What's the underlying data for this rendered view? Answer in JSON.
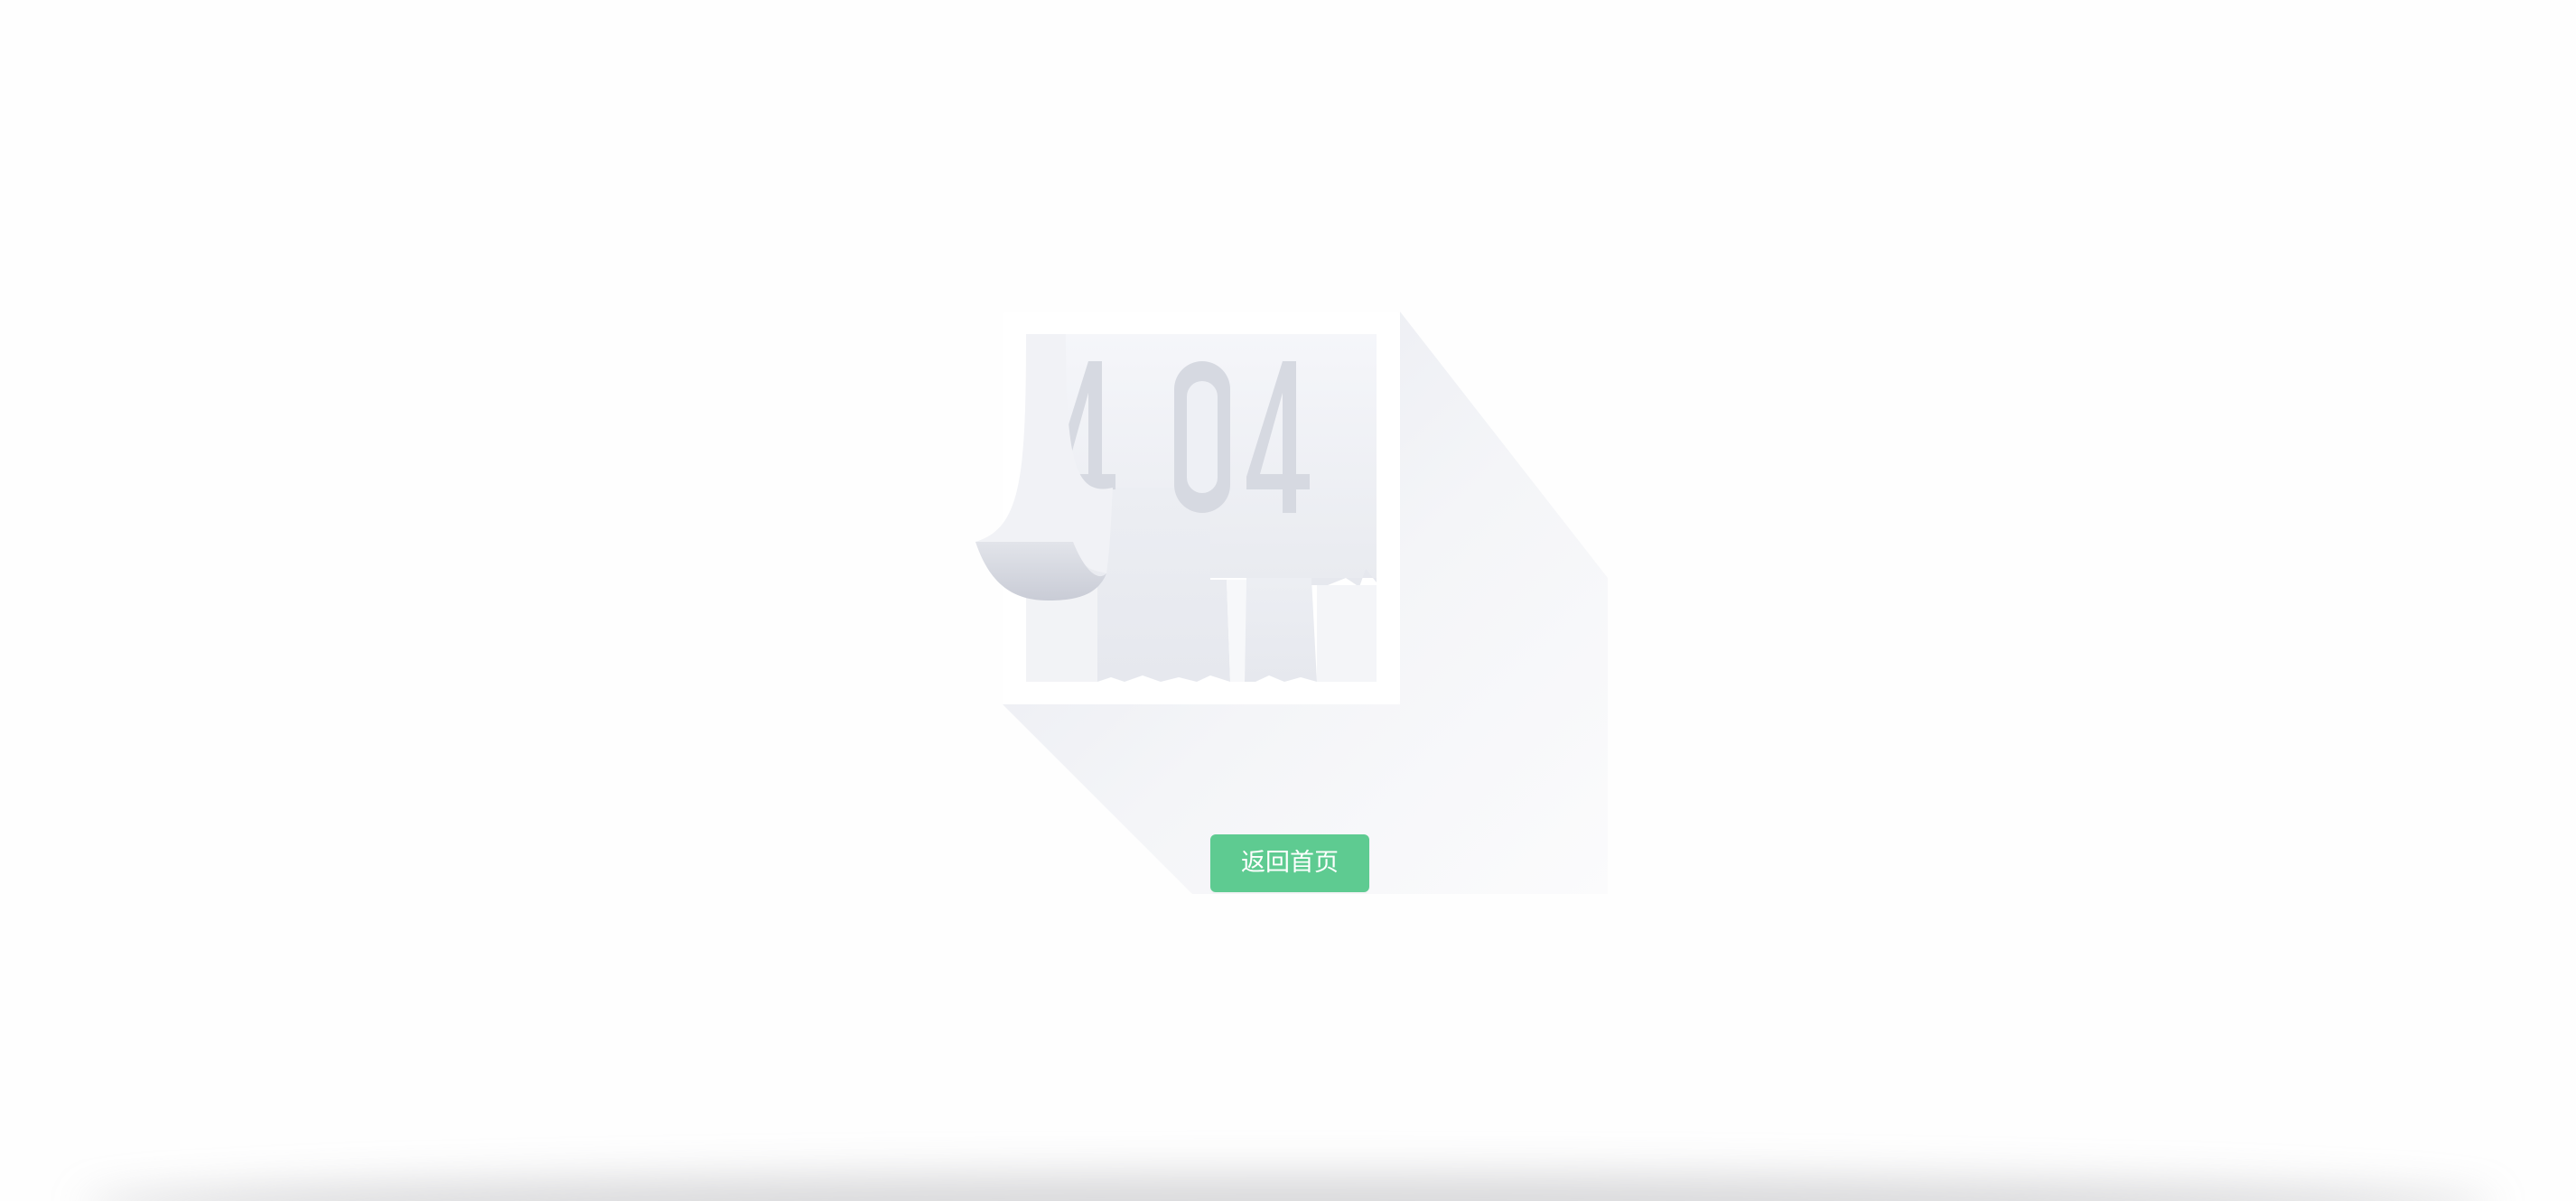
{
  "illustration": {
    "error_code": "404",
    "colors": {
      "paper": "#eef0f5",
      "paper_top": "#f5f6fa",
      "digits": "#d6d9e1",
      "curl": "#cfd2dc",
      "shadow": "#eceef3"
    }
  },
  "actions": {
    "home_label": "返回首页",
    "home_color": "#5ecb91"
  }
}
